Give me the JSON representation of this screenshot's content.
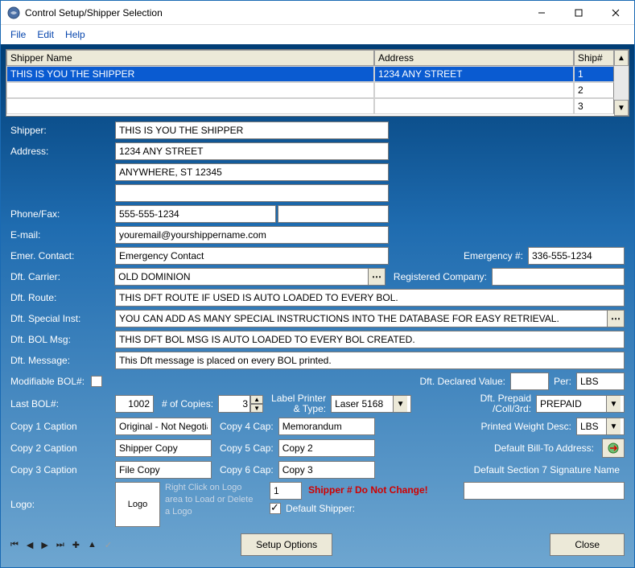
{
  "window": {
    "title": "Control Setup/Shipper Selection"
  },
  "menu": {
    "file": "File",
    "edit": "Edit",
    "help": "Help"
  },
  "grid": {
    "headers": {
      "shipper": "Shipper Name",
      "address": "Address",
      "shipno": "Ship#"
    },
    "rows": [
      {
        "shipper": "THIS IS YOU THE SHIPPER",
        "address": "1234 ANY STREET",
        "shipno": "1"
      },
      {
        "shipper": "",
        "address": "",
        "shipno": "2"
      },
      {
        "shipper": "",
        "address": "",
        "shipno": "3"
      }
    ]
  },
  "labels": {
    "shipper": "Shipper:",
    "address": "Address:",
    "phone": "Phone/Fax:",
    "email": "E-mail:",
    "emer_contact": "Emer. Contact:",
    "emer_num": "Emergency #:",
    "dft_carrier": "Dft. Carrier:",
    "reg_company": "Registered Company:",
    "dft_route": "Dft. Route:",
    "dft_special": "Dft. Special Inst:",
    "dft_bol_msg": "Dft. BOL Msg:",
    "dft_message": "Dft. Message:",
    "mod_bol": "Modifiable BOL#:",
    "dft_decl_val": "Dft. Declared Value:",
    "per": "Per:",
    "last_bol": "Last BOL#:",
    "copies": "# of Copies:",
    "label_printer": "Label Printer\n& Type:",
    "dft_prepaid": "Dft. Prepaid\n/Coll/3rd:",
    "copy1": "Copy 1 Caption",
    "copy2": "Copy 2 Caption",
    "copy3": "Copy 3 Caption",
    "copy4": "Copy 4 Cap:",
    "copy5": "Copy 5 Cap:",
    "copy6": "Copy 6 Cap:",
    "printed_weight": "Printed Weight Desc:",
    "default_billto": "Default Bill-To Address:",
    "default_sec7": "Default Section 7 Signature Name",
    "logo": "Logo:",
    "logo_hint": "Right Click on Logo area to Load or Delete a Logo",
    "shipper_no_warn": "Shipper # Do Not Change!",
    "default_shipper": "Default Shipper:"
  },
  "values": {
    "shipper": "THIS IS YOU THE SHIPPER",
    "addr1": "1234 ANY STREET",
    "addr2": "ANYWHERE, ST 12345",
    "addr3": "",
    "phone": "555-555-1234",
    "fax": "",
    "email": "youremail@yourshippername.com",
    "emer_contact": "Emergency Contact",
    "emer_num": "336-555-1234",
    "dft_carrier": "OLD DOMINION",
    "reg_company": "",
    "dft_route": "THIS DFT ROUTE IF USED IS AUTO LOADED TO EVERY BOL.",
    "dft_special": "YOU CAN ADD AS MANY SPECIAL INSTRUCTIONS INTO THE DATABASE FOR EASY RETRIEVAL.",
    "dft_bol_msg": "THIS DFT BOL MSG IS AUTO LOADED TO EVERY BOL CREATED.",
    "dft_message": "This Dft message is placed on every BOL printed.",
    "mod_bol_checked": false,
    "decl_val": "",
    "per": "LBS",
    "last_bol": "1002",
    "copies": "3",
    "label_printer": "Laser 5168",
    "dft_prepaid": "PREPAID",
    "copy1": "Original - Not Negotia",
    "copy2": "Shipper Copy",
    "copy3": "File Copy",
    "copy4": "Memorandum",
    "copy5": "Copy 2",
    "copy6": "Copy 3",
    "printed_weight": "LBS",
    "sec7_name": "",
    "shipper_number": "1",
    "default_shipper_checked": true,
    "logo_text": "Logo"
  },
  "buttons": {
    "setup_options": "Setup Options",
    "close": "Close"
  }
}
